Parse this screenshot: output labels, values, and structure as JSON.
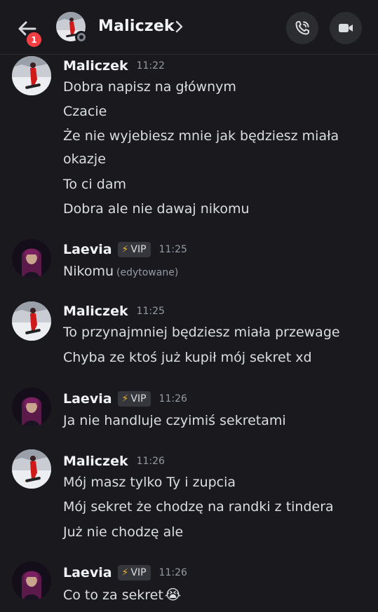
{
  "header": {
    "badge_count": "1",
    "contact_name": "Maliczek",
    "chevron": "›"
  },
  "messages": [
    {
      "author": "Maliczek",
      "time": "11:22",
      "vip": "",
      "lines": [
        "Dobra napisz na głównym",
        "Czacie",
        "Że nie wyjebiesz mnie jak będziesz miała",
        "okazje",
        "To ci dam",
        "Dobra ale nie dawaj nikomu"
      ]
    },
    {
      "author": "Laevia",
      "time": "11:25",
      "vip": "VIP",
      "lines": [
        "Nikomu"
      ],
      "edited": "(edytowane)"
    },
    {
      "author": "Maliczek",
      "time": "11:25",
      "vip": "",
      "lines": [
        "To przynajmniej będziesz miała przewage",
        "Chyba ze ktoś już kupił mój sekret xd"
      ]
    },
    {
      "author": "Laevia",
      "time": "11:26",
      "vip": "VIP",
      "lines": [
        "Ja nie handluje czyimiś sekretami"
      ]
    },
    {
      "author": "Maliczek",
      "time": "11:26",
      "vip": "",
      "lines": [
        "Mój masz tylko Ty i zupcia",
        "Mój sekret że chodzę na randki z tindera",
        "Już nie chodzę ale"
      ]
    },
    {
      "author": "Laevia",
      "time": "11:26",
      "vip": "VIP",
      "lines": [
        "Co to za sekret"
      ],
      "emoji": "😭"
    }
  ],
  "colors": {
    "background": "#1a1a1e",
    "text": "#dbdee1",
    "muted": "#949ba4",
    "badge": "#f23f43",
    "vip_bolt": "#f0b232"
  },
  "icons": [
    "back-arrow-icon",
    "phone-icon",
    "video-camera-icon",
    "lightning-icon"
  ]
}
